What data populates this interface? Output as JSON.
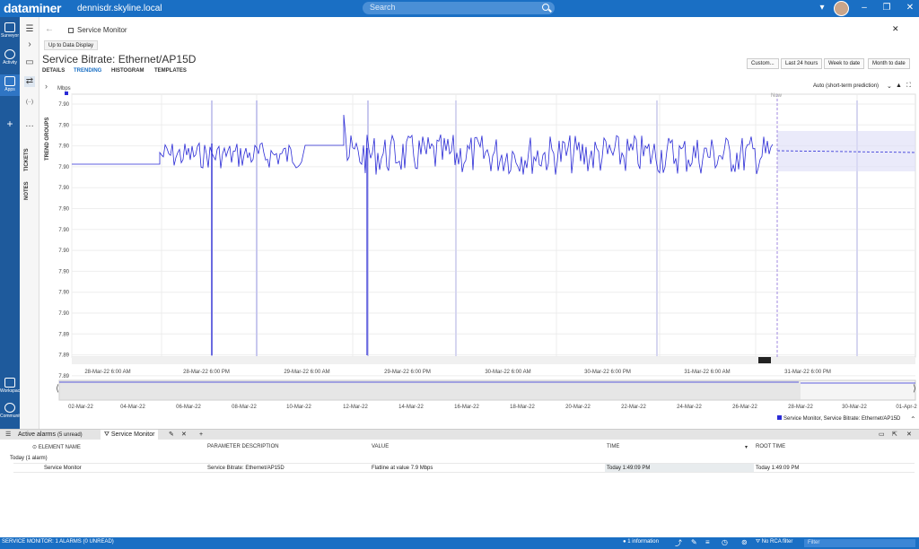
{
  "app": {
    "brand": "dataminer",
    "host": "dennisdr.skyline.local",
    "search_placeholder": "Search"
  },
  "leftnav": {
    "items": [
      {
        "label": "Surveyor",
        "icon": "surveyor-icon"
      },
      {
        "label": "Activity",
        "icon": "activity-icon"
      },
      {
        "label": "Apps",
        "icon": "apps-icon"
      },
      {
        "label": "Workspace",
        "icon": "workspace-icon"
      },
      {
        "label": "Community",
        "icon": "community-icon"
      }
    ]
  },
  "side2": {
    "labels": [
      "TREND GROUPS",
      "TICKETS",
      "NOTES"
    ]
  },
  "card": {
    "tab_title": "Service Monitor",
    "up_button": "Up to Data Display",
    "title": "Service Bitrate: Ethernet/AP15D",
    "subtabs": [
      "DETAILS",
      "TRENDING",
      "HISTOGRAM",
      "TEMPLATES"
    ],
    "active_subtab": "TRENDING",
    "range_buttons": [
      "Custom...",
      "Last 24 hours",
      "Week to date",
      "Month to date"
    ],
    "prediction_label": "Auto (short-term prediction)"
  },
  "chart_data": {
    "type": "line",
    "ylabel": "Mbps",
    "yticks": [
      "7.90",
      "7.90",
      "7.90",
      "7.90",
      "7.90",
      "7.90",
      "7.90",
      "7.90",
      "7.90",
      "7.90",
      "7.90",
      "7.89",
      "7.89",
      "7.89"
    ],
    "xticks": [
      "28-Mar-22 6:00 AM",
      "28-Mar-22 6:00 PM",
      "29-Mar-22 6:00 AM",
      "29-Mar-22 6:00 PM",
      "30-Mar-22 6:00 AM",
      "30-Mar-22 6:00 PM",
      "31-Mar-22 6:00 AM",
      "31-Mar-22 6:00 PM"
    ],
    "now_label": "Now",
    "overview_ticks": [
      "02-Mar-22",
      "04-Mar-22",
      "06-Mar-22",
      "08-Mar-22",
      "10-Mar-22",
      "12-Mar-22",
      "14-Mar-22",
      "16-Mar-22",
      "18-Mar-22",
      "20-Mar-22",
      "22-Mar-22",
      "24-Mar-22",
      "26-Mar-22",
      "28-Mar-22",
      "30-Mar-22",
      "01-Apr-2"
    ],
    "legend": "Service Monitor, Service Bitrate: Ethernet/AP15D",
    "series_color": "#2b2bd6",
    "prediction_band_color": "#dcdcf7",
    "grid": true
  },
  "alarms": {
    "tab_active": "Active alarms",
    "tab_active_count": "(5 unread)",
    "tab_filter": "Service Monitor",
    "headers": [
      "ELEMENT NAME",
      "PARAMETER DESCRIPTION",
      "VALUE",
      "TIME",
      "ROOT TIME"
    ],
    "group": "Today (1 alarm)",
    "rows": [
      {
        "element": "Service Monitor",
        "parameter": "Service Bitrate: Ethernet/AP15D",
        "value": "Flatline at value 7.9 Mbps",
        "time": "Today 1:49:09 PM",
        "root_time": "Today 1:49:09 PM"
      }
    ]
  },
  "status": {
    "left": "SERVICE MONITOR: 1 ALARMS (0 UNREAD)",
    "info": "1 information",
    "rca": "No RCA filter",
    "filter_placeholder": "Filter"
  }
}
